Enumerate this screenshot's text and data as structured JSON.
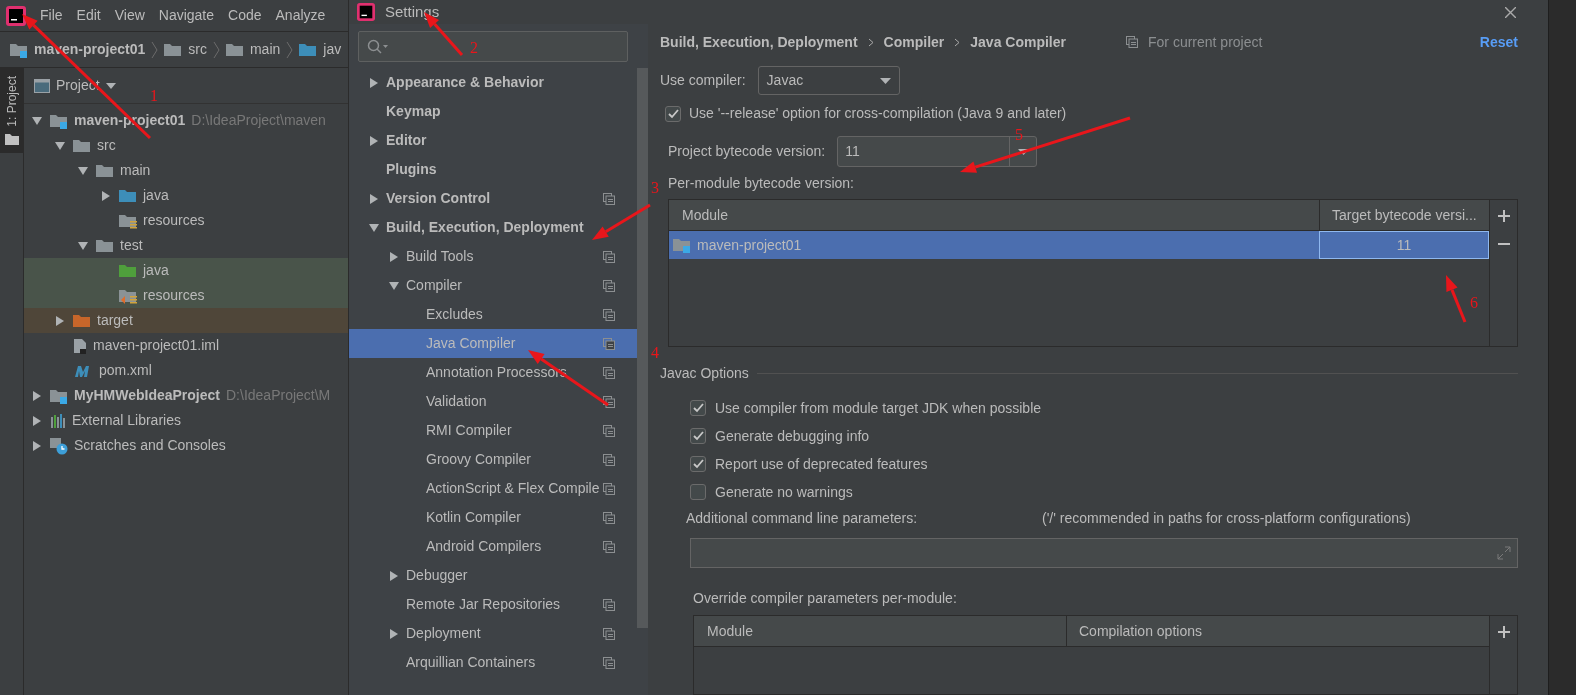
{
  "ide": {
    "menu": [
      {
        "label": "File"
      },
      {
        "label": "Edit"
      },
      {
        "label": "View"
      },
      {
        "label": "Navigate"
      },
      {
        "label": "Code"
      },
      {
        "label": "Analyze"
      }
    ],
    "breadcrumb": [
      {
        "label": "maven-project01",
        "kind": "module"
      },
      {
        "label": "src",
        "kind": "folder"
      },
      {
        "label": "main",
        "kind": "folder"
      },
      {
        "label": "jav",
        "kind": "source"
      }
    ],
    "tool_tab": {
      "label": "1: Project",
      "selected": true
    },
    "project_panel": {
      "title": "Project",
      "tree": [
        {
          "label": "maven-project01",
          "path": "D:\\IdeaProject\\maven",
          "kind": "module",
          "expanded": true,
          "children": [
            {
              "label": "src",
              "kind": "folder",
              "expanded": true,
              "children": [
                {
                  "label": "main",
                  "kind": "folder",
                  "expanded": true,
                  "children": [
                    {
                      "label": "java",
                      "kind": "source",
                      "expanded": false
                    },
                    {
                      "label": "resources",
                      "kind": "resources"
                    }
                  ]
                },
                {
                  "label": "test",
                  "kind": "folder",
                  "expanded": true,
                  "children": [
                    {
                      "label": "java",
                      "kind": "test-source"
                    },
                    {
                      "label": "resources",
                      "kind": "test-resources"
                    }
                  ]
                }
              ]
            },
            {
              "label": "target",
              "kind": "excluded",
              "expanded": false
            },
            {
              "label": "maven-project01.iml",
              "kind": "iml"
            },
            {
              "label": "pom.xml",
              "kind": "maven"
            }
          ]
        },
        {
          "label": "MyHMWebIdeaProject",
          "path": "D:\\IdeaProject\\M",
          "kind": "module",
          "expanded": false
        },
        {
          "label": "External Libraries",
          "kind": "libraries",
          "expanded": false
        },
        {
          "label": "Scratches and Consoles",
          "kind": "scratches",
          "expanded": false
        }
      ]
    }
  },
  "settings": {
    "title": "Settings",
    "nav": [
      {
        "label": "Appearance & Behavior",
        "expanded": false,
        "selected": false,
        "per_project": false
      },
      {
        "label": "Keymap",
        "selected": false,
        "per_project": false
      },
      {
        "label": "Editor",
        "expanded": false,
        "selected": false,
        "per_project": false
      },
      {
        "label": "Plugins",
        "selected": false,
        "per_project": false
      },
      {
        "label": "Version Control",
        "expanded": false,
        "selected": false,
        "per_project": true
      },
      {
        "label": "Build, Execution, Deployment",
        "expanded": true,
        "selected": false,
        "per_project": false,
        "children": [
          {
            "label": "Build Tools",
            "expanded": false,
            "selected": false,
            "per_project": true
          },
          {
            "label": "Compiler",
            "expanded": true,
            "selected": false,
            "per_project": true,
            "children": [
              {
                "label": "Excludes",
                "selected": false,
                "per_project": true
              },
              {
                "label": "Java Compiler",
                "selected": true,
                "per_project": true
              },
              {
                "label": "Annotation Processors",
                "selected": false,
                "per_project": true
              },
              {
                "label": "Validation",
                "selected": false,
                "per_project": true
              },
              {
                "label": "RMI Compiler",
                "selected": false,
                "per_project": true
              },
              {
                "label": "Groovy Compiler",
                "selected": false,
                "per_project": true
              },
              {
                "label": "ActionScript & Flex Compile",
                "selected": false,
                "per_project": true
              },
              {
                "label": "Kotlin Compiler",
                "selected": false,
                "per_project": true
              },
              {
                "label": "Android Compilers",
                "selected": false,
                "per_project": true
              }
            ]
          },
          {
            "label": "Debugger",
            "expanded": false,
            "selected": false,
            "per_project": false
          },
          {
            "label": "Remote Jar Repositories",
            "selected": false,
            "per_project": true
          },
          {
            "label": "Deployment",
            "expanded": false,
            "selected": false,
            "per_project": true
          },
          {
            "label": "Arquillian Containers",
            "selected": false,
            "per_project": true
          }
        ]
      }
    ],
    "page": {
      "breadcrumb": [
        "Build, Execution, Deployment",
        "Compiler",
        "Java Compiler"
      ],
      "scope": "For current project",
      "reset": "Reset",
      "use_compiler": {
        "label": "Use compiler:",
        "value": "Javac"
      },
      "release_option": {
        "label": "Use '--release' option for cross-compilation (Java 9 and later)",
        "checked": true
      },
      "project_bytecode": {
        "label": "Project bytecode version:",
        "value": "11"
      },
      "per_module": {
        "label": "Per-module bytecode version:",
        "columns": [
          "Module",
          "Target bytecode versi..."
        ],
        "rows": [
          {
            "module": "maven-project01",
            "target": "11",
            "selected": true
          }
        ]
      },
      "javac_options": {
        "title": "Javac Options",
        "checkboxes": [
          {
            "label": "Use compiler from module target JDK when possible",
            "checked": true
          },
          {
            "label": "Generate debugging info",
            "checked": true
          },
          {
            "label": "Report use of deprecated features",
            "checked": true
          },
          {
            "label": "Generate no warnings",
            "checked": false
          }
        ],
        "additional": {
          "label": "Additional command line parameters:",
          "hint": "('/' recommended in paths for cross-platform configurations)"
        },
        "override": {
          "label": "Override compiler parameters per-module:",
          "columns": [
            "Module",
            "Compilation options"
          ]
        }
      }
    }
  },
  "annotations": [
    {
      "label": "1"
    },
    {
      "label": "2"
    },
    {
      "label": "3"
    },
    {
      "label": "4"
    },
    {
      "label": "5"
    },
    {
      "label": "6"
    }
  ]
}
